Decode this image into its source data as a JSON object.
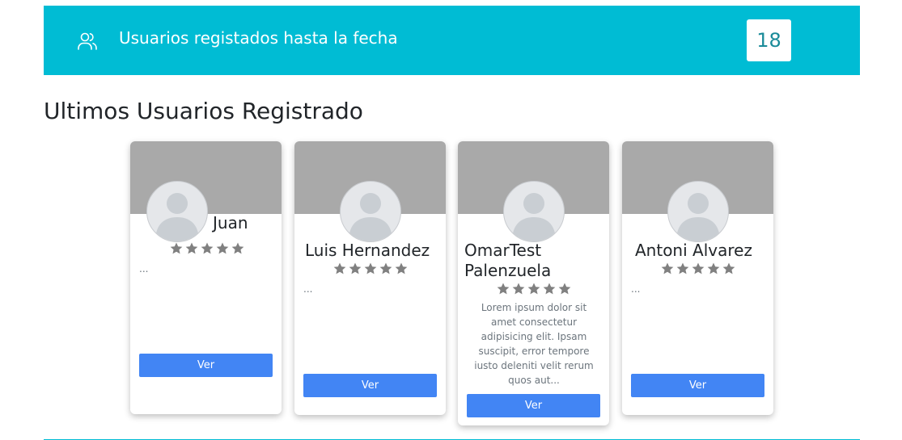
{
  "banner": {
    "icon": "users-icon",
    "title": "Usuarios registados hasta la fecha",
    "count": "18",
    "color": "#00bcd4"
  },
  "section_title": "Ultimos Usuarios Registrado",
  "cards": [
    {
      "name": "Juan",
      "rating": 5,
      "description": "...",
      "button": "Ver"
    },
    {
      "name": "Luis Hernandez",
      "rating": 5,
      "description": "...",
      "button": "Ver"
    },
    {
      "name": "OmarTest Palenzuela",
      "rating": 5,
      "description": "Lorem ipsum dolor sit amet consectetur adipisicing elit. Ipsam suscipit, error tempore iusto deleniti velit rerum quos aut...",
      "button": "Ver"
    },
    {
      "name": "Antoni Alvarez",
      "rating": 5,
      "description": "...",
      "button": "Ver"
    }
  ],
  "colors": {
    "header_gray": "#a9a9a9",
    "button_blue": "#4285f4",
    "star_gray": "#808080"
  }
}
